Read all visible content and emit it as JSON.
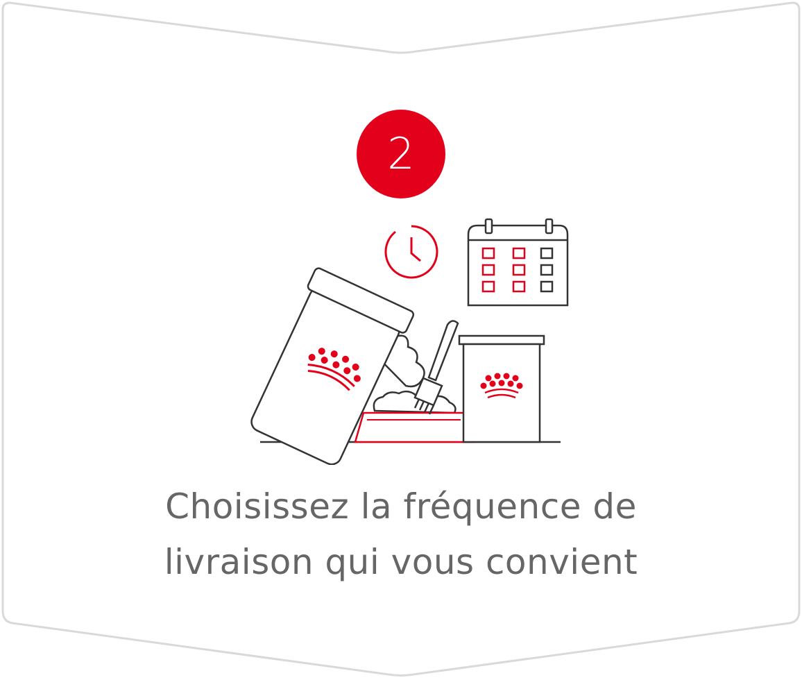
{
  "step": {
    "number": "2"
  },
  "caption": {
    "line1": "Choisissez la fréquence de",
    "line2": "livraison qui vous convient"
  },
  "illustration": {
    "icons": [
      "clock-icon",
      "calendar-icon",
      "pouch-icon",
      "food-bowl-icon",
      "fork-icon",
      "food-can-icon"
    ]
  },
  "colors": {
    "accent": "#e2001a",
    "outline": "#333333",
    "text": "#666666",
    "border": "#d9d9d9"
  }
}
